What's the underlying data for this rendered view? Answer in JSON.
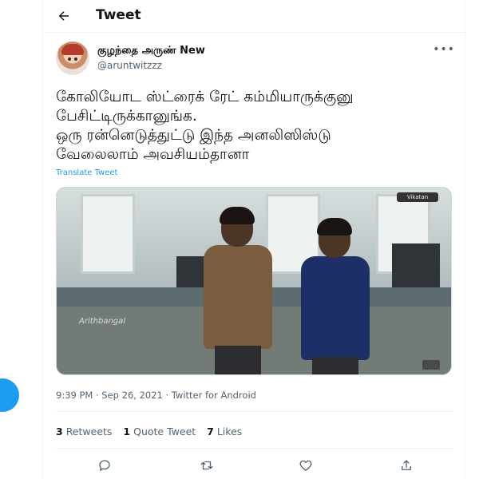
{
  "header": {
    "title": "Tweet",
    "back_icon": "arrow-left-icon"
  },
  "author": {
    "name": "குழந்தை அருண் New",
    "handle": "@aruntwitzzz"
  },
  "tweet": {
    "text": "கோலியோட ஸ்ட்ரைக் ரேட் கம்மியாருக்குனு\nபேசிட்டிருக்கானுங்க.\nஒரு ரன்னெடுத்துட்டு இந்த அனலிஸிஸ்டு\nவேலைலாம் அவசியம்தானா",
    "translate_label": "Translate Tweet"
  },
  "media": {
    "watermark": "Arithbangal",
    "badge": "Vikatan"
  },
  "meta": {
    "timestamp": "9:39 PM · Sep 26, 2021 · Twitter for Android"
  },
  "stats": [
    {
      "count": "3",
      "label": "Retweets"
    },
    {
      "count": "1",
      "label": "Quote Tweet"
    },
    {
      "count": "7",
      "label": "Likes"
    }
  ],
  "actions": [
    "reply-icon",
    "retweet-icon",
    "like-icon",
    "share-icon"
  ],
  "colors": {
    "accent": "#1d9bf0",
    "text": "#0f1419",
    "muted": "#536471",
    "border": "#eff3f4"
  }
}
